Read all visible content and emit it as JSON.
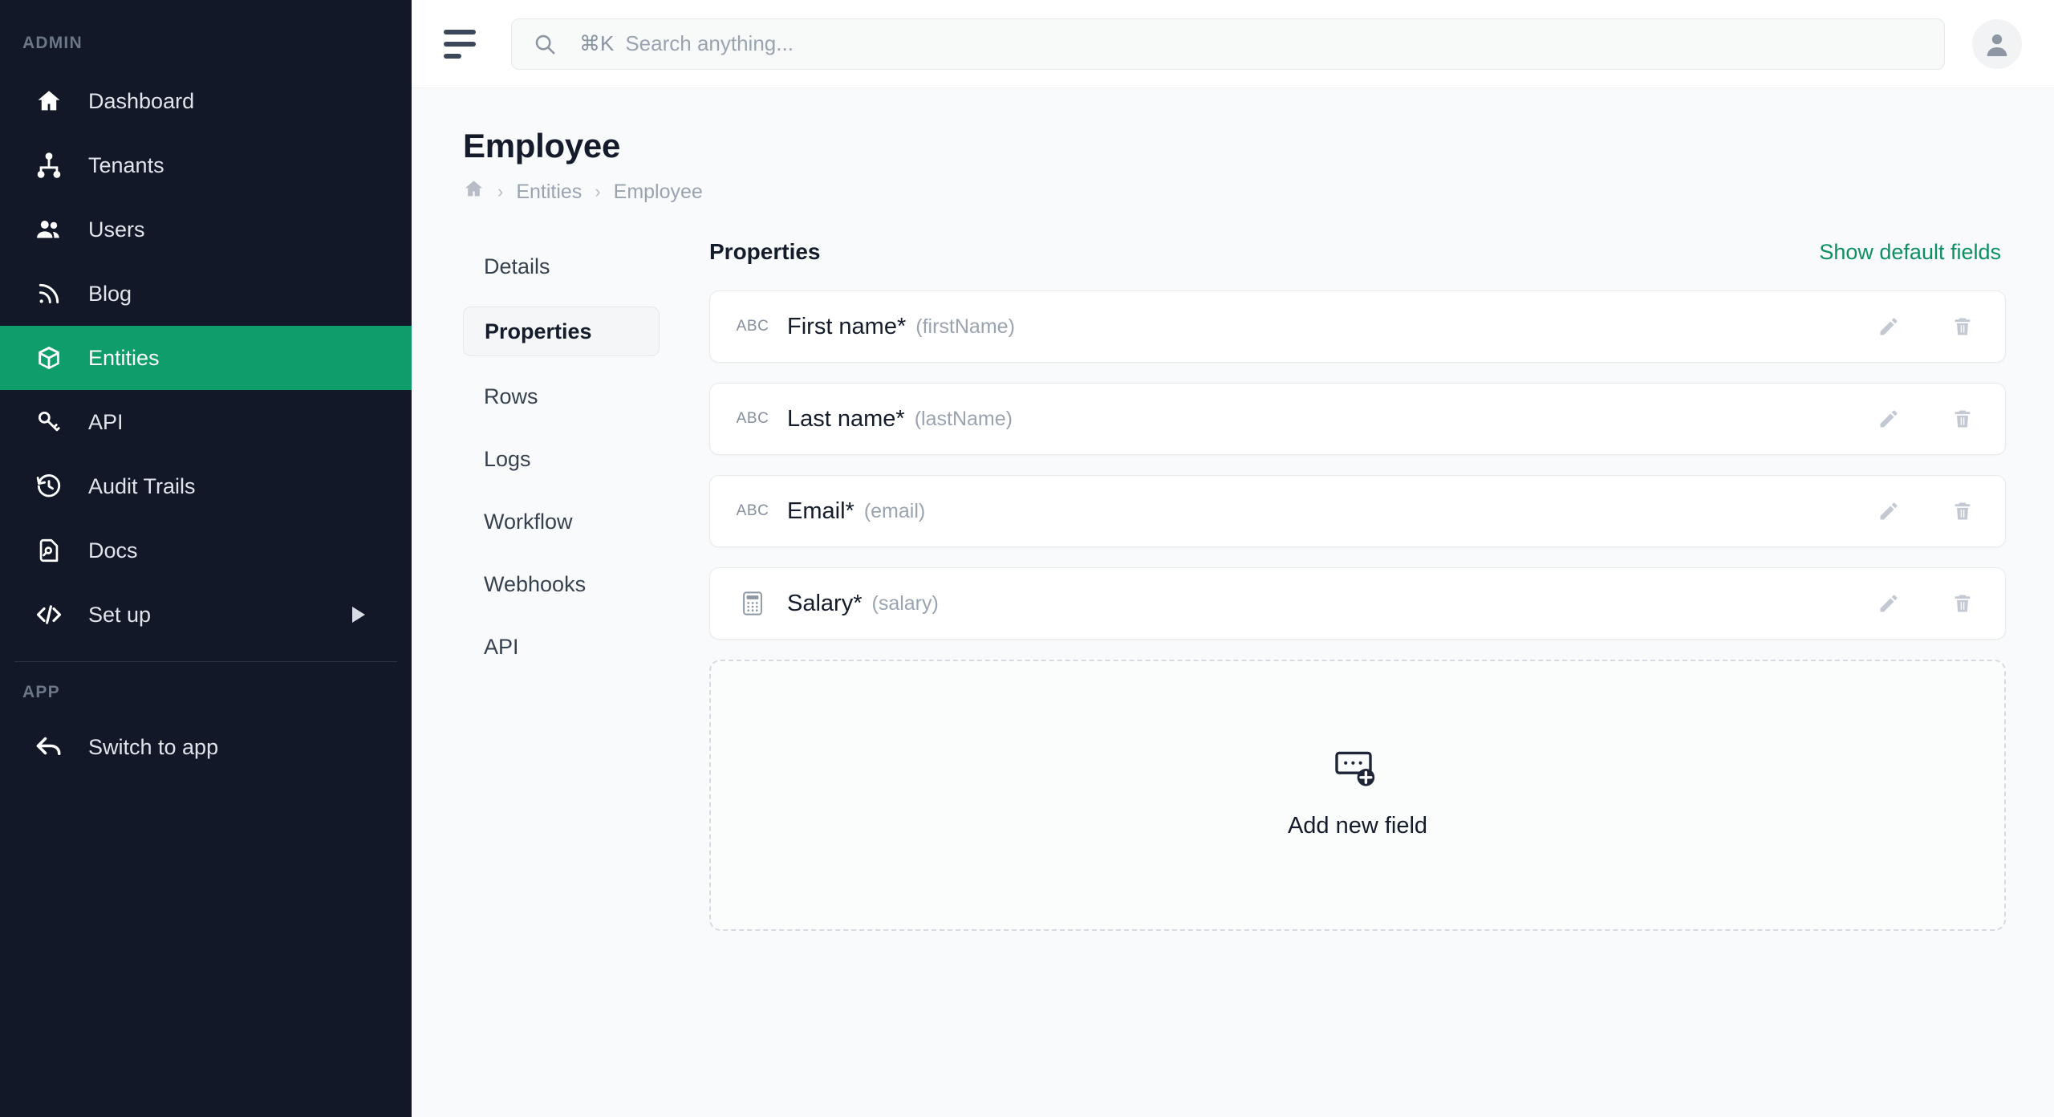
{
  "sidebar": {
    "admin_label": "ADMIN",
    "app_label": "APP",
    "admin_items": [
      {
        "label": "Dashboard",
        "icon": "home-icon",
        "active": false
      },
      {
        "label": "Tenants",
        "icon": "sitemap-icon",
        "active": false
      },
      {
        "label": "Users",
        "icon": "users-icon",
        "active": false
      },
      {
        "label": "Blog",
        "icon": "rss-icon",
        "active": false
      },
      {
        "label": "Entities",
        "icon": "cube-icon",
        "active": true
      },
      {
        "label": "API",
        "icon": "key-icon",
        "active": false
      },
      {
        "label": "Audit Trails",
        "icon": "history-icon",
        "active": false
      },
      {
        "label": "Docs",
        "icon": "document-search-icon",
        "active": false
      },
      {
        "label": "Set up",
        "icon": "code-icon",
        "active": false,
        "expandable": true
      }
    ],
    "app_items": [
      {
        "label": "Switch to app",
        "icon": "back-arrow-icon"
      }
    ]
  },
  "topbar": {
    "menu_icon": "hamburger-icon",
    "search": {
      "icon": "search-icon",
      "shortcut": "⌘K",
      "placeholder": "Search anything..."
    },
    "avatar_icon": "user-avatar-icon"
  },
  "page": {
    "title": "Employee",
    "breadcrumb": [
      {
        "label": "",
        "icon": "home-icon"
      },
      {
        "label": "Entities"
      },
      {
        "label": "Employee"
      }
    ],
    "breadcrumb_separator": "›"
  },
  "subnav": {
    "items": [
      {
        "label": "Details",
        "active": false
      },
      {
        "label": "Properties",
        "active": true
      },
      {
        "label": "Rows",
        "active": false
      },
      {
        "label": "Logs",
        "active": false
      },
      {
        "label": "Workflow",
        "active": false
      },
      {
        "label": "Webhooks",
        "active": false
      },
      {
        "label": "API",
        "active": false
      }
    ]
  },
  "properties_panel": {
    "title": "Properties",
    "show_default_fields_label": "Show default fields",
    "edit_icon": "pencil-icon",
    "delete_icon": "trash-icon",
    "rows": [
      {
        "name": "First name",
        "required_mark": "*",
        "key": "(firstName)",
        "type_icon": "abc-text-icon",
        "type_glyph": "ABC"
      },
      {
        "name": "Last name",
        "required_mark": "*",
        "key": "(lastName)",
        "type_icon": "abc-text-icon",
        "type_glyph": "ABC"
      },
      {
        "name": "Email",
        "required_mark": "*",
        "key": "(email)",
        "type_icon": "abc-text-icon",
        "type_glyph": "ABC"
      },
      {
        "name": "Salary",
        "required_mark": "*",
        "key": "(salary)",
        "type_icon": "calculator-number-icon",
        "type_glyph": ""
      }
    ],
    "add_field": {
      "label": "Add new field",
      "icon": "add-field-icon"
    }
  },
  "colors": {
    "sidebar_bg": "#121827",
    "accent_green": "#0f9d6b",
    "link_green": "#0d8f62",
    "page_bg": "#f9fafb",
    "text_dark": "#141c2b",
    "text_muted": "#9aa3b0"
  }
}
